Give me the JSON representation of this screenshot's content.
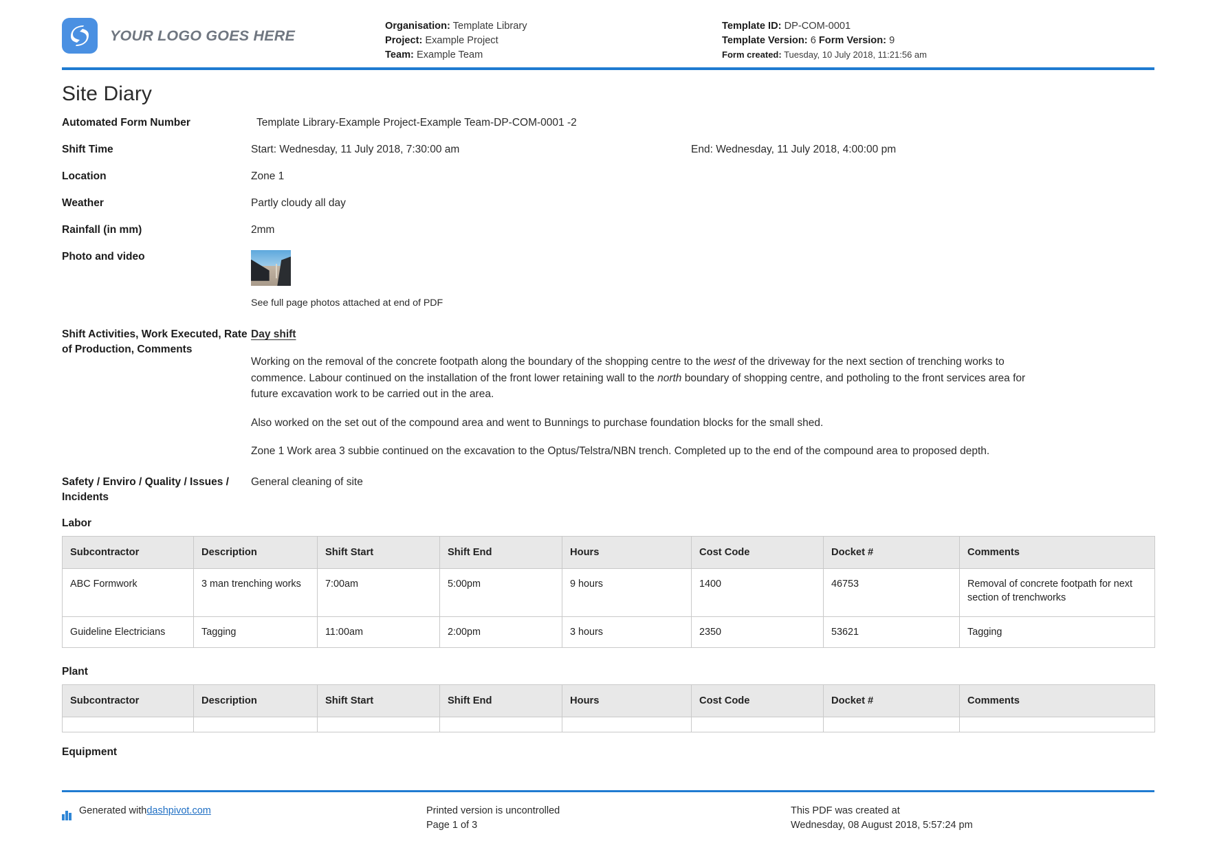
{
  "header": {
    "logo_text": "YOUR LOGO GOES HERE",
    "logo_icon": "dashpivot-logo-icon",
    "accent_color": "#1f7bd1",
    "org_label": "Organisation:",
    "org_value": "Template Library",
    "project_label": "Project:",
    "project_value": "Example Project",
    "team_label": "Team:",
    "team_value": "Example Team",
    "template_id_label": "Template ID:",
    "template_id_value": "DP-COM-0001",
    "template_version_label": "Template Version:",
    "template_version_value": "6",
    "form_version_label": "Form Version:",
    "form_version_value": "9",
    "form_created_label": "Form created:",
    "form_created_value": "Tuesday, 10 July 2018, 11:21:56 am"
  },
  "title": "Site Diary",
  "fields": {
    "form_number_label": "Automated Form Number",
    "form_number_value": "Template Library-Example Project-Example Team-DP-COM-0001   -2",
    "shift_time_label": "Shift Time",
    "shift_start_value": "Start: Wednesday, 11 July 2018, 7:30:00 am",
    "shift_end_value": "End: Wednesday, 11 July 2018, 4:00:00 pm",
    "location_label": "Location",
    "location_value": "Zone 1",
    "weather_label": "Weather",
    "weather_value": "Partly cloudy all day",
    "rainfall_label": "Rainfall (in mm)",
    "rainfall_value": "2mm",
    "photo_label": "Photo and video",
    "photo_caption": "See full page photos attached at end of PDF",
    "activities_label": "Shift Activities, Work Executed, Rate of Production, Comments",
    "activities_subheading": "Day shift",
    "activities_paragraphs": [
      {
        "p1": "Working on the removal of the concrete footpath along the boundary of the shopping centre to the ",
        "em1": "west",
        "p2": " of the driveway for the next section of trenching works to commence. Labour continued on the installation of the front lower retaining wall to the ",
        "em2": "north",
        "p3": " boundary of shopping centre, and potholing to the front services area for future excavation work to be carried out in the area."
      }
    ],
    "activities_p2": "Also worked on the set out of the compound area and went to Bunnings to purchase foundation blocks for the small shed.",
    "activities_p3": "Zone 1 Work area 3 subbie continued on the excavation to the Optus/Telstra/NBN trench. Completed up to the end of the compound area to proposed depth.",
    "safety_label": "Safety / Enviro / Quality / Issues / Incidents",
    "safety_value": "General cleaning of site"
  },
  "tables": {
    "columns": [
      "Subcontractor",
      "Description",
      "Shift Start",
      "Shift End",
      "Hours",
      "Cost Code",
      "Docket #",
      "Comments"
    ],
    "labor": {
      "title": "Labor",
      "rows": [
        [
          "ABC Formwork",
          "3 man trenching works",
          "7:00am",
          "5:00pm",
          "9 hours",
          "1400",
          "46753",
          "Removal of concrete footpath for next section of trenchworks"
        ],
        [
          "Guideline Electricians",
          "Tagging",
          "11:00am",
          "2:00pm",
          "3 hours",
          "2350",
          "53621",
          "Tagging"
        ]
      ]
    },
    "plant": {
      "title": "Plant",
      "rows": [
        [
          "",
          "",
          "",
          "",
          "",
          "",
          "",
          ""
        ]
      ]
    },
    "equipment": {
      "title": "Equipment"
    }
  },
  "footer": {
    "generated_prefix": "Generated with ",
    "generated_link": "dashpivot.com",
    "uncontrolled": "Printed version is uncontrolled",
    "page": "Page 1 of 3",
    "created_at_label": "This PDF was created at",
    "created_at_value": "Wednesday, 08 August 2018, 5:57:24 pm"
  }
}
